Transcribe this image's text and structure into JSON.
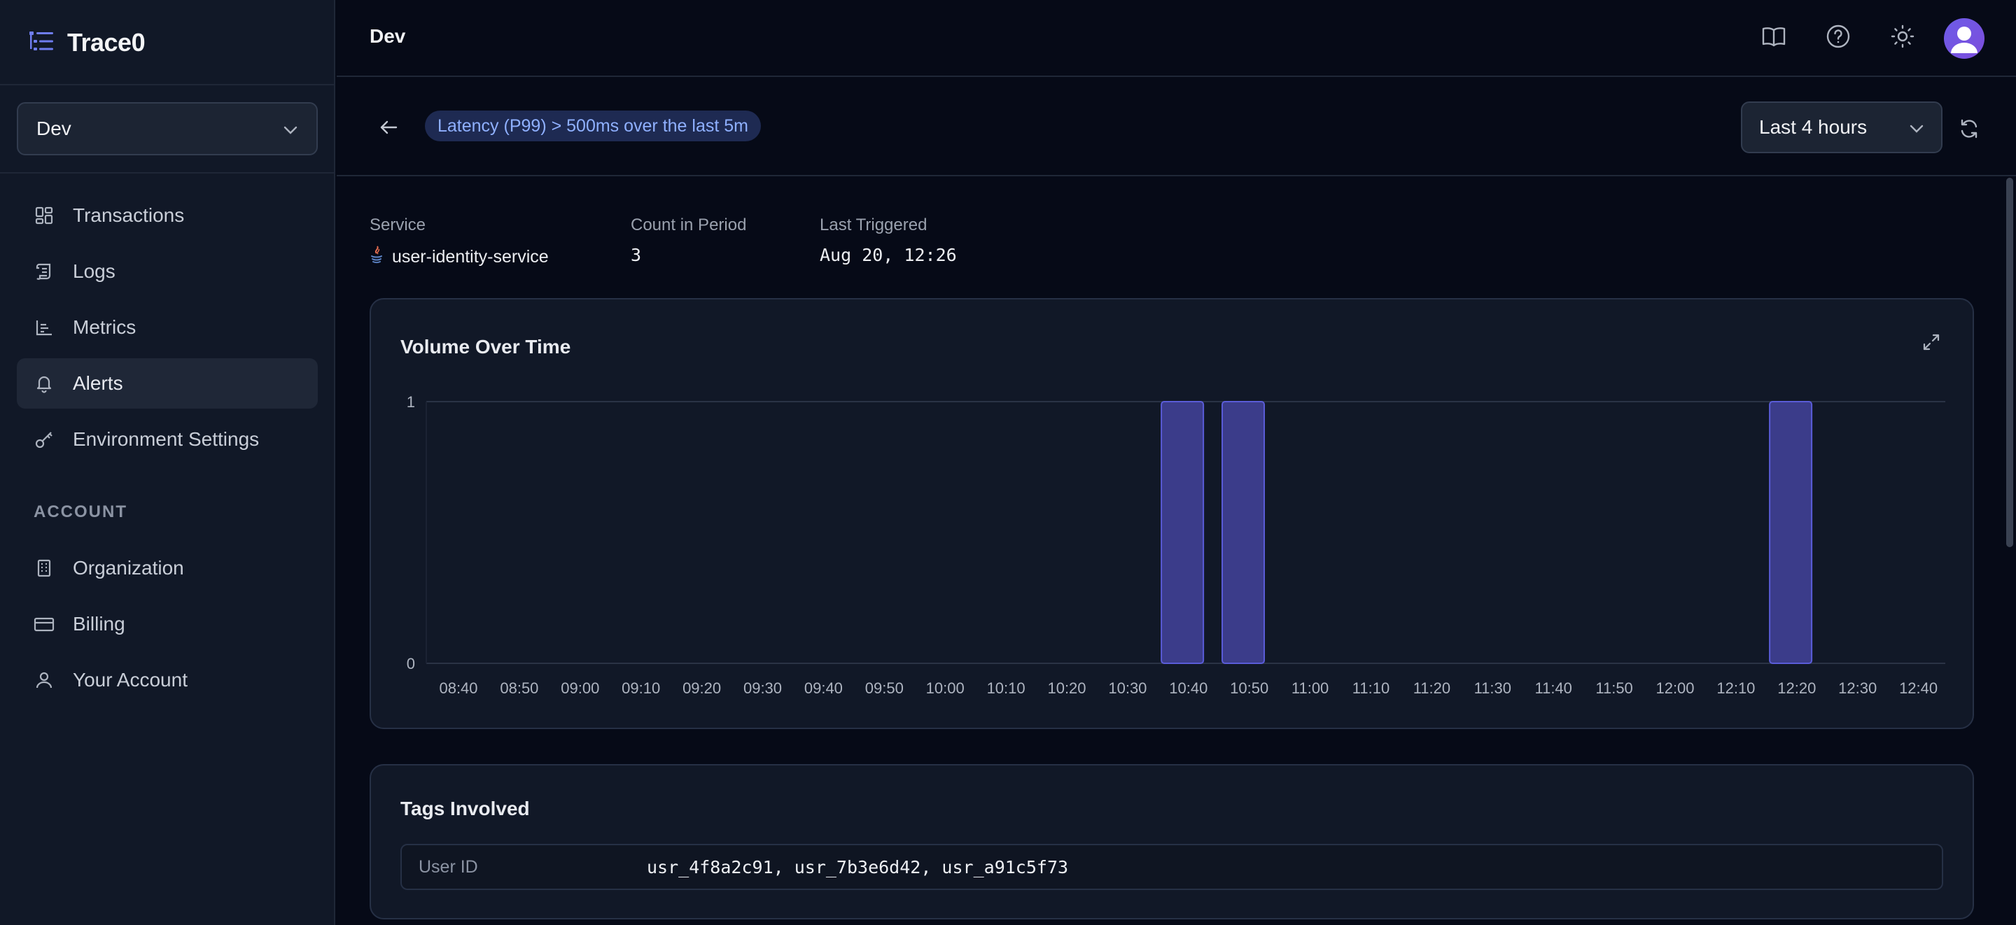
{
  "app": {
    "name": "Trace0"
  },
  "sidebar": {
    "environment": "Dev",
    "nav": [
      {
        "label": "Transactions",
        "icon": "grid-icon"
      },
      {
        "label": "Logs",
        "icon": "scroll-icon"
      },
      {
        "label": "Metrics",
        "icon": "bar-chart-icon"
      },
      {
        "label": "Alerts",
        "icon": "bell-icon",
        "active": true
      },
      {
        "label": "Environment Settings",
        "icon": "key-icon"
      }
    ],
    "account_section": "ACCOUNT",
    "account_nav": [
      {
        "label": "Organization",
        "icon": "building-icon"
      },
      {
        "label": "Billing",
        "icon": "credit-card-icon"
      },
      {
        "label": "Your Account",
        "icon": "user-icon"
      }
    ]
  },
  "topbar": {
    "title": "Dev"
  },
  "alert": {
    "name": "Latency (P99) > 500ms over the last 5m",
    "time_range": "Last 4 hours"
  },
  "meta": {
    "service_label": "Service",
    "service_value": "user-identity-service",
    "count_label": "Count in Period",
    "count_value": "3",
    "last_label": "Last Triggered",
    "last_value": "Aug 20, 12:26"
  },
  "volume_card": {
    "title": "Volume Over Time"
  },
  "chart_data": {
    "type": "bar",
    "title": "Volume Over Time",
    "x": [
      "08:40",
      "08:50",
      "09:00",
      "09:10",
      "09:20",
      "09:30",
      "09:40",
      "09:50",
      "10:00",
      "10:10",
      "10:20",
      "10:30",
      "10:40",
      "10:50",
      "11:00",
      "11:10",
      "11:20",
      "11:30",
      "11:40",
      "11:50",
      "12:00",
      "12:10",
      "12:20",
      "12:30",
      "12:40"
    ],
    "bars": [
      {
        "time": "10:39",
        "value": 1
      },
      {
        "time": "10:49",
        "value": 1
      },
      {
        "time": "12:19",
        "value": 1
      }
    ],
    "y_ticks": [
      0,
      1
    ],
    "ylim": [
      0,
      1
    ],
    "bar_color": "#3b3c8a",
    "bar_border": "#5a5cd8"
  },
  "tags_card": {
    "title": "Tags Involved",
    "rows": [
      {
        "key": "User ID",
        "value": "usr_4f8a2c91, usr_7b3e6d42, usr_a91c5f73"
      }
    ]
  }
}
